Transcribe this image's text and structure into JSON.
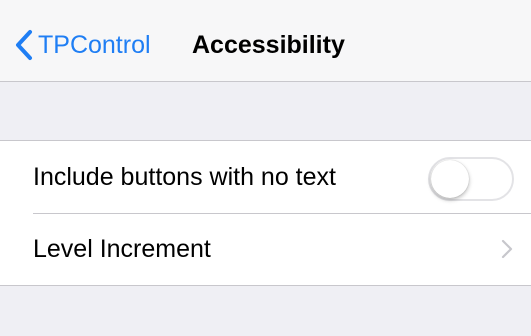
{
  "navbar": {
    "back_label": "TPControl",
    "title": "Accessibility",
    "back_icon": "chevron-left-icon"
  },
  "settings": {
    "rows": [
      {
        "label": "Include buttons with no text",
        "control": "toggle",
        "toggle_on": false
      },
      {
        "label": "Level Increment",
        "control": "disclosure",
        "icon": "chevron-right-icon"
      }
    ]
  },
  "colors": {
    "accent": "#1f7ef4",
    "background": "#efeff4",
    "separator": "#c8c7cc",
    "disclosure": "#c7c7cc"
  }
}
